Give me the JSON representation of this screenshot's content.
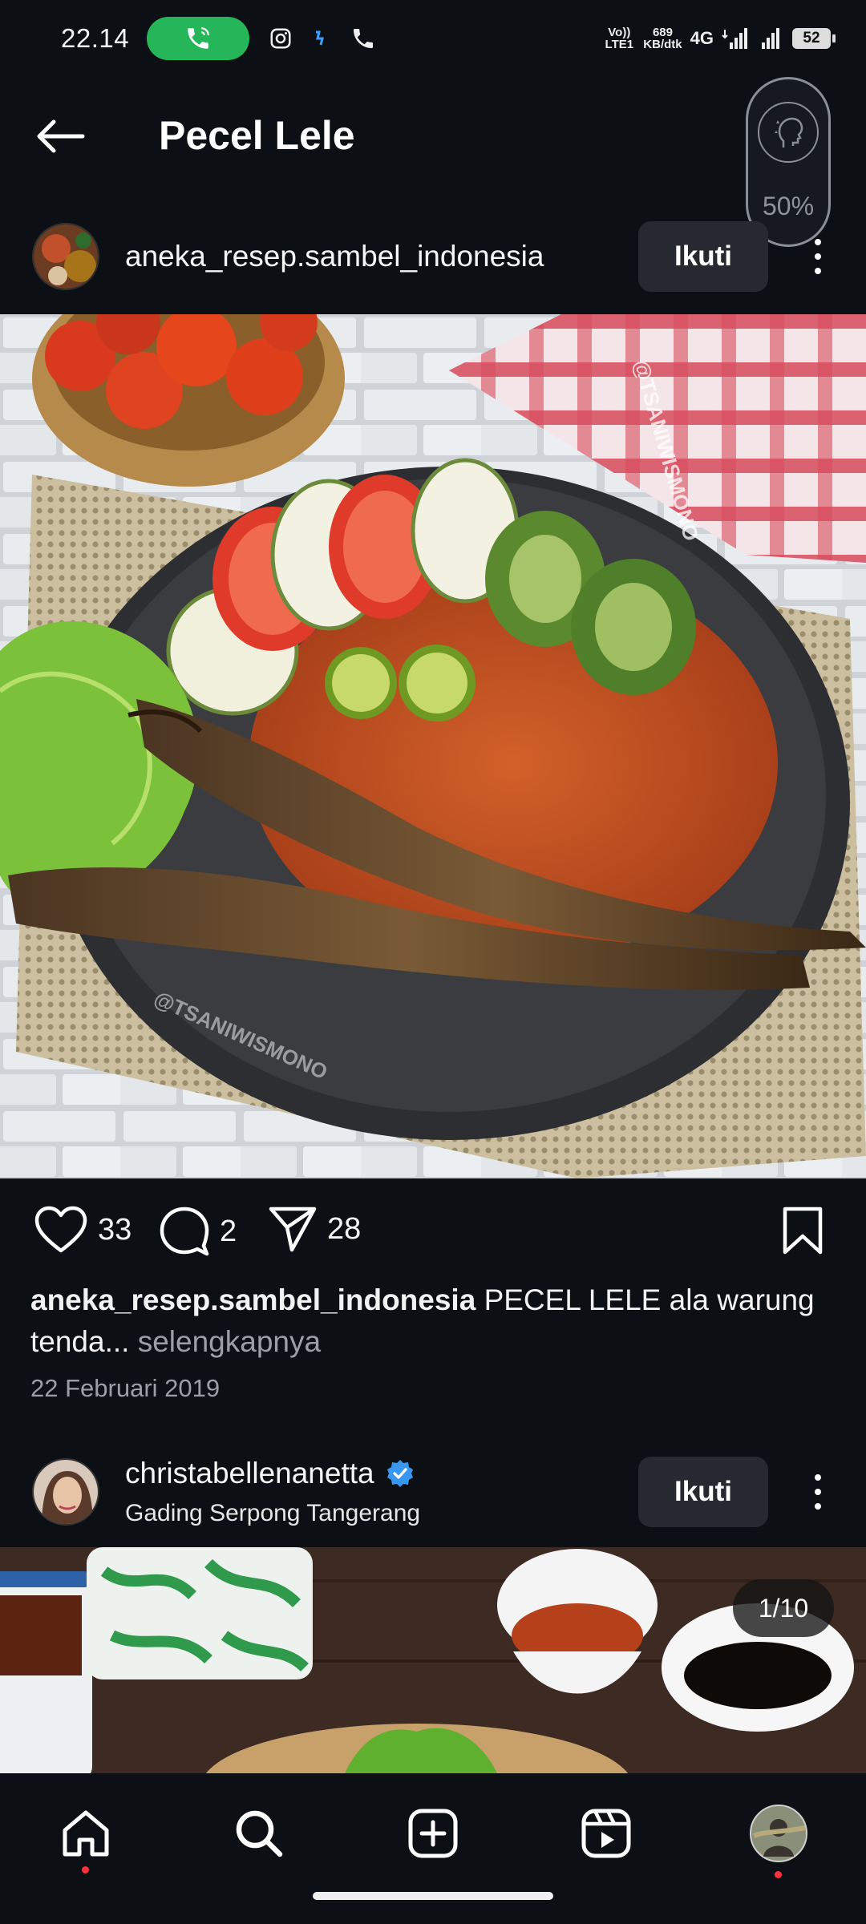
{
  "status_bar": {
    "time": "22.14",
    "volte": "Vo)) LTE1",
    "speed_value": "689",
    "speed_unit": "KB/dtk",
    "network": "4G",
    "battery": "52"
  },
  "header": {
    "title": "Pecel Lele"
  },
  "widget": {
    "percent": "50%"
  },
  "post1": {
    "username": "aneka_resep.sambel_indonesia",
    "follow_label": "Ikuti",
    "image_watermark": "@TSANIWISMONO",
    "likes": "33",
    "comments": "2",
    "shares": "28",
    "caption_user": "aneka_resep.sambel_indonesia",
    "caption_text": "PECEL LELE ala warung tenda",
    "caption_ellipsis": "...",
    "caption_more": "selengkapnya",
    "date": "22 Februari 2019"
  },
  "post2": {
    "username": "christabellenanetta",
    "location": "Gading Serpong Tangerang",
    "follow_label": "Ikuti",
    "counter": "1/10"
  },
  "colors": {
    "background": "#0c0f14",
    "call_green": "#24b659",
    "verified_blue": "#3897f0",
    "button_bg": "#262a30",
    "notify_red": "#ff3040"
  },
  "nav": {
    "items": [
      "home-icon",
      "search-icon",
      "create-icon",
      "reels-icon",
      "profile-avatar"
    ]
  }
}
